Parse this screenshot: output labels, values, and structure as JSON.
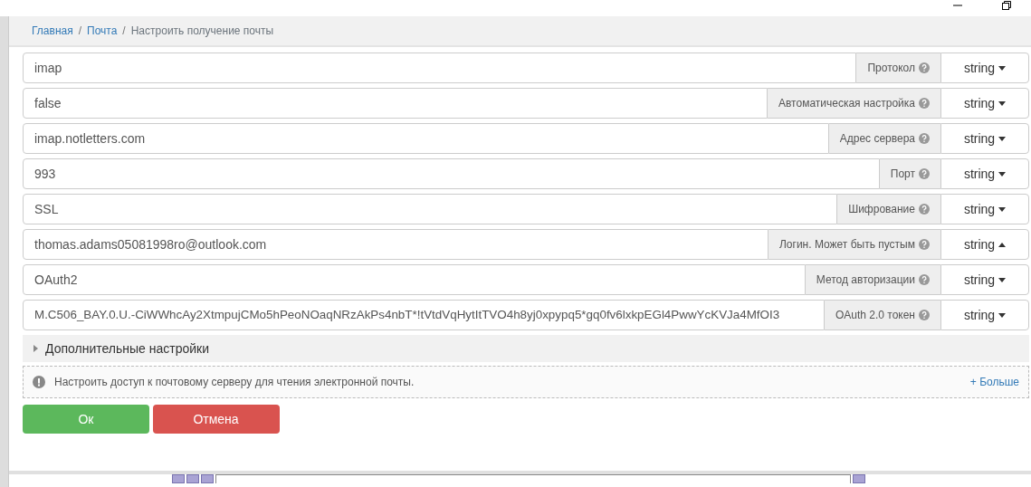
{
  "breadcrumb": [
    {
      "label": "Главная",
      "kind": "link"
    },
    {
      "label": "/",
      "kind": "separator"
    },
    {
      "label": "Почта",
      "kind": "link"
    },
    {
      "label": "/",
      "kind": "separator"
    },
    {
      "label": "Настроить получение почты",
      "kind": "current"
    }
  ],
  "fields": [
    {
      "value": "imap",
      "label": "Протокол",
      "type": "string",
      "expanded": false
    },
    {
      "value": "false",
      "label": "Автоматическая настройка",
      "type": "string",
      "expanded": false
    },
    {
      "value": "imap.notletters.com",
      "label": "Адрес сервера",
      "type": "string",
      "expanded": false
    },
    {
      "value": "993",
      "label": "Порт",
      "type": "string",
      "expanded": false
    },
    {
      "value": "SSL",
      "label": "Шифрование",
      "type": "string",
      "expanded": false
    },
    {
      "value": "thomas.adams05081998ro@outlook.com",
      "label": "Логин. Может быть пустым",
      "type": "string",
      "expanded": true
    },
    {
      "value": "OAuth2",
      "label": "Метод авторизации",
      "type": "string",
      "expanded": false
    },
    {
      "value": "M.C506_BAY.0.U.-CiWWhcAy2XtmpujCMo5hPeoNOaqNRzAkPs4nbT*!tVtdVqHytItTVO4h8yj0xpypq5*gq0fv6lxkpEGl4PwwYcKVJa4MfOI3",
      "label": "OAuth 2.0 токен",
      "type": "string",
      "expanded": false
    }
  ],
  "advanced": {
    "label": "Дополнительные настройки",
    "expanded": false
  },
  "info": {
    "text": "Настроить доступ к почтовому серверу для чтения электронной почты.",
    "more": "+ Больше"
  },
  "buttons": [
    {
      "label": "Ок",
      "kind": "ok"
    },
    {
      "label": "Отмена",
      "kind": "cancel"
    }
  ]
}
